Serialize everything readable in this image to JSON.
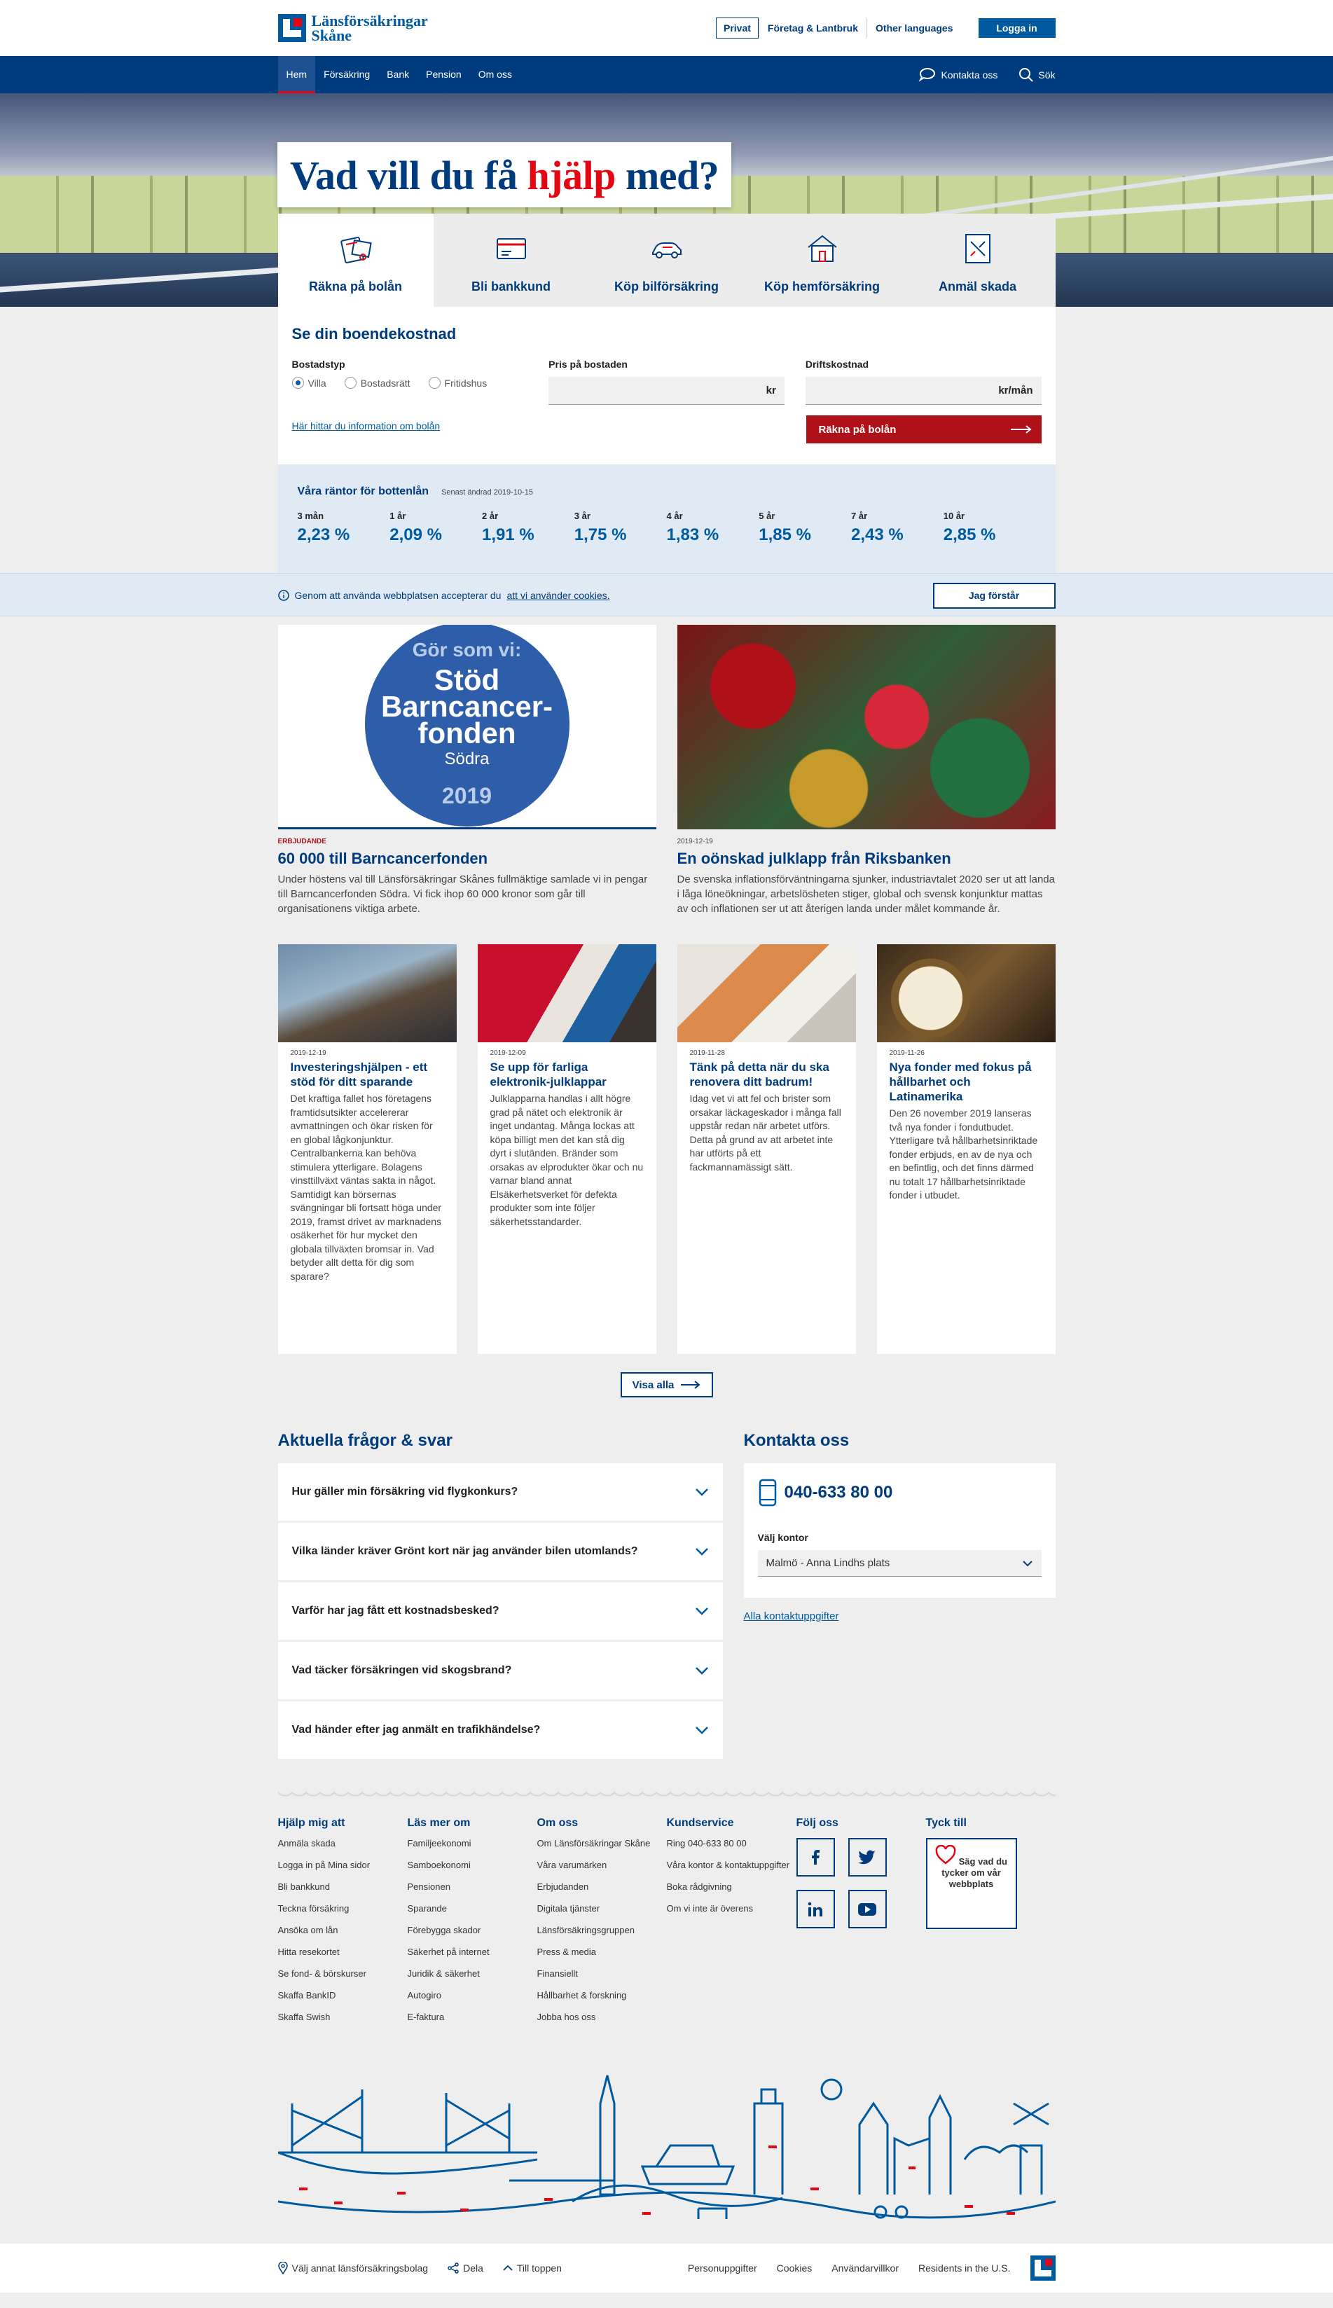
{
  "brand": {
    "line1": "Länsförsäkringar",
    "line2": "Skåne"
  },
  "top_links": [
    "Privat",
    "Företag & Lantbruk",
    "Other languages"
  ],
  "login_label": "Logga in",
  "nav": {
    "items": [
      "Hem",
      "Försäkring",
      "Bank",
      "Pension",
      "Om oss"
    ],
    "active": "Hem",
    "contact_label": "Kontakta oss",
    "search_label": "Sök"
  },
  "hero": {
    "part1": "Vad vill du få ",
    "highlight": "hjälp",
    "part2": " med?"
  },
  "tabs": [
    {
      "label": "Räkna på bolån",
      "icon": "calculator-icon",
      "active": true
    },
    {
      "label": "Bli bankkund",
      "icon": "card-icon",
      "active": false
    },
    {
      "label": "Köp bilförsäkring",
      "icon": "car-icon",
      "active": false
    },
    {
      "label": "Köp hemförsäkring",
      "icon": "house-icon",
      "active": false
    },
    {
      "label": "Anmäl skada",
      "icon": "report-icon",
      "active": false
    }
  ],
  "calculator": {
    "title": "Se din boendekostnad",
    "housing_label": "Bostadstyp",
    "options": [
      "Villa",
      "Bostadsrätt",
      "Fritidshus"
    ],
    "selected": "Villa",
    "price_label": "Pris på bostaden",
    "price_unit": "kr",
    "cost_label": "Driftskostnad",
    "cost_unit": "kr/mån",
    "info_link": "Här hittar du information om bolån",
    "submit": "Räkna på bolån"
  },
  "rates": {
    "title": "Våra räntor för bottenlån",
    "updated": "Senast ändrad 2019-10-15",
    "items": [
      {
        "term": "3 mån",
        "value": "2,23 %"
      },
      {
        "term": "1 år",
        "value": "2,09 %"
      },
      {
        "term": "2 år",
        "value": "1,91 %"
      },
      {
        "term": "3 år",
        "value": "1,75 %"
      },
      {
        "term": "4 år",
        "value": "1,83 %"
      },
      {
        "term": "5 år",
        "value": "1,85 %"
      },
      {
        "term": "7 år",
        "value": "2,43 %"
      },
      {
        "term": "10 år",
        "value": "2,85 %"
      }
    ]
  },
  "cookie": {
    "text": "Genom att använda webbplatsen accepterar du ",
    "link": "att vi använder cookies.",
    "button": "Jag förstår"
  },
  "featured": [
    {
      "tag": "ERBJUDANDE",
      "title": "60 000 till Barncancerfonden",
      "text": "Under höstens val till Länsförsäkringar Skånes fullmäktige samlade vi in pengar till Barncancerfonden Södra. Vi fick ihop 60 000 kronor som går till organisationens viktiga arbete.",
      "badge": {
        "top": "Gör som vi:",
        "main": "Stöd Barncancer-fonden",
        "sub": "Södra",
        "year": "2019"
      }
    },
    {
      "date": "2019-12-19",
      "title": "En oönskad julklapp från Riksbanken",
      "text": "De svenska inflationsförväntningarna sjunker, industriavtalet 2020 ser ut att landa i låga löneökningar, arbetslösheten stiger, global och svensk konjunktur mattas av och inflationen ser ut att återigen landa under målet kommande år."
    }
  ],
  "news": [
    {
      "date": "2019-12-19",
      "title": "Investeringshjälpen - ett stöd för ditt sparande",
      "text": "Det kraftiga fallet hos företagens framtidsutsikter accelererar avmattningen och ökar risken för en global lågkonjunktur. Centralbankerna kan behöva stimulera ytterligare. Bolagens vinsttillväxt väntas sakta in något. Samtidigt kan börsernas svängningar bli fortsatt höga under 2019, framst drivet av marknadens osäkerhet för hur mycket den globala tillväxten bromsar in. Vad betyder allt detta för dig som sparare?"
    },
    {
      "date": "2019-12-09",
      "title": "Se upp för farliga elektronik-julklappar",
      "text": "Julklapparna handlas i allt högre grad på nätet och elektronik är inget undantag. Många lockas att köpa billigt men det kan stå dig dyrt i slutänden. Bränder som orsakas av elprodukter ökar och nu varnar bland annat Elsäkerhetsverket för defekta produkter som inte följer säkerhetsstandarder."
    },
    {
      "date": "2019-11-28",
      "title": "Tänk på detta när du ska renovera ditt badrum!",
      "text": "Idag vet vi att fel och brister som orsakar läckageskador i många fall uppstår redan när arbetet utförs. Detta på grund av att arbetet inte har utförts på ett fackmannamässigt sätt."
    },
    {
      "date": "2019-11-26",
      "title": "Nya fonder med fokus på hållbarhet och Latinamerika",
      "text": "Den 26 november 2019 lanseras två nya fonder i fondutbudet. Ytterligare två hållbarhetsinriktade fonder erbjuds, en av de nya och en befintlig, och det finns därmed nu totalt 17 hållbarhetsinriktade fonder i utbudet."
    }
  ],
  "show_all": "Visa alla",
  "faq": {
    "title": "Aktuella frågor & svar",
    "items": [
      "Hur gäller min försäkring vid flygkonkurs?",
      "Vilka länder kräver Grönt kort när jag använder bilen utomlands?",
      "Varför har jag fått ett kostnadsbesked?",
      "Vad täcker försäkringen vid skogsbrand?",
      "Vad händer efter jag anmält en trafikhändelse?"
    ]
  },
  "contact": {
    "title": "Kontakta oss",
    "phone": "040-633 80 00",
    "office_label": "Välj kontor",
    "office_value": "Malmö - Anna Lindhs plats",
    "all_link": "Alla kontaktuppgifter"
  },
  "footer": {
    "cols": [
      {
        "title": "Hjälp mig att",
        "links": [
          "Anmäla skada",
          "Logga in på Mina sidor",
          "Bli bankkund",
          "Teckna försäkring",
          "Ansöka om lån",
          "Hitta resekortet",
          "Se fond- & börskurser",
          "Skaffa BankID",
          "Skaffa Swish"
        ]
      },
      {
        "title": "Läs mer om",
        "links": [
          "Familjeekonomi",
          "Samboekonomi",
          "Pensionen",
          "Sparande",
          "Förebygga skador",
          "Säkerhet på internet",
          "Juridik & säkerhet",
          "Autogiro",
          "E-faktura"
        ]
      },
      {
        "title": "Om oss",
        "links": [
          "Om Länsförsäkringar Skåne",
          "Våra varumärken",
          "Erbjudanden",
          "Digitala tjänster",
          "Länsförsäkringsgruppen",
          "Press & media",
          "Finansiellt",
          "Hållbarhet & forskning",
          "Jobba hos oss"
        ]
      },
      {
        "title": "Kundservice",
        "links": [
          "Ring 040-633 80 00",
          "Våra kontor & kontaktuppgifter",
          "Boka rådgivning",
          "Om vi inte är överens"
        ]
      }
    ],
    "follow_title": "Följ oss",
    "social": [
      "facebook-icon",
      "twitter-icon",
      "linkedin-icon",
      "youtube-icon"
    ],
    "feedback_title": "Tyck till",
    "feedback_text": "Säg vad du tycker om vår webbplats"
  },
  "bottom": {
    "left": [
      "Välj annat länsförsäkringsbolag",
      "Dela",
      "Till toppen"
    ],
    "right": [
      "Personuppgifter",
      "Cookies",
      "Användarvillkor",
      "Residents in the U.S."
    ]
  },
  "colors": {
    "primary": "#003c7d",
    "accent": "#005aa0",
    "red": "#e30613",
    "button_red": "#b01018",
    "rates_bg": "#dfeaf5"
  }
}
